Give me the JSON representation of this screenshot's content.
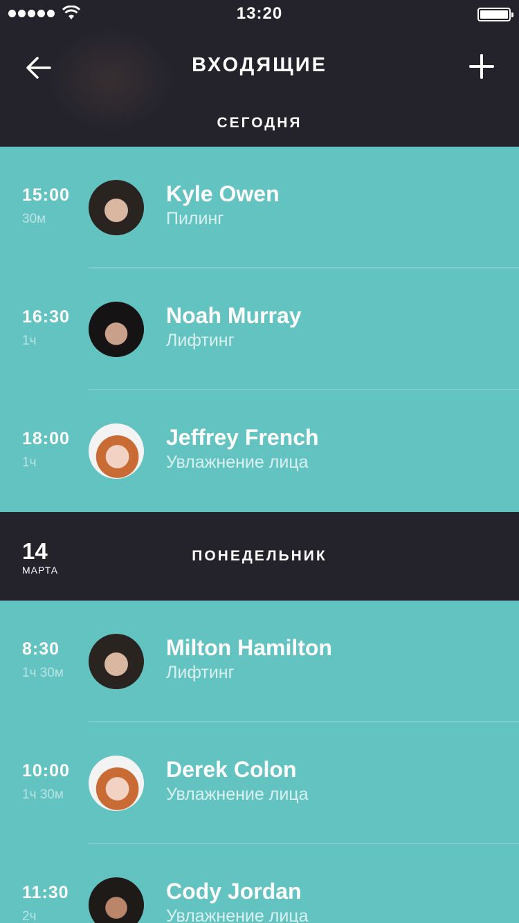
{
  "status_bar": {
    "time": "13:20"
  },
  "header": {
    "title": "ВХОДЯЩИЕ",
    "section_label": "СЕГОДНЯ"
  },
  "today_appointments": [
    {
      "time": "15:00",
      "duration": "30м",
      "name": "Kyle Owen",
      "service": "Пилинг"
    },
    {
      "time": "16:30",
      "duration": "1ч",
      "name": "Noah Murray",
      "service": "Лифтинг"
    },
    {
      "time": "18:00",
      "duration": "1ч",
      "name": "Jeffrey French",
      "service": "Увлажнение лица"
    }
  ],
  "day_section": {
    "day": "14",
    "month": "МАРТА",
    "weekday": "ПОНЕДЕЛЬНИК"
  },
  "monday_appointments": [
    {
      "time": "8:30",
      "duration": "1ч 30м",
      "name": "Milton Hamilton",
      "service": "Лифтинг"
    },
    {
      "time": "10:00",
      "duration": "1ч 30м",
      "name": "Derek Colon",
      "service": "Увлажнение лица"
    },
    {
      "time": "11:30",
      "duration": "2ч",
      "name": "Cody Jordan",
      "service": "Увлажнение лица"
    }
  ],
  "icons": [
    "signal-dots-icon",
    "wifi-icon",
    "battery-icon",
    "back-arrow-icon",
    "plus-icon",
    "avatar-photo"
  ],
  "colors": {
    "header_bg": "#24232c",
    "list_bg": "#63c3c1",
    "text": "#ffffff"
  }
}
